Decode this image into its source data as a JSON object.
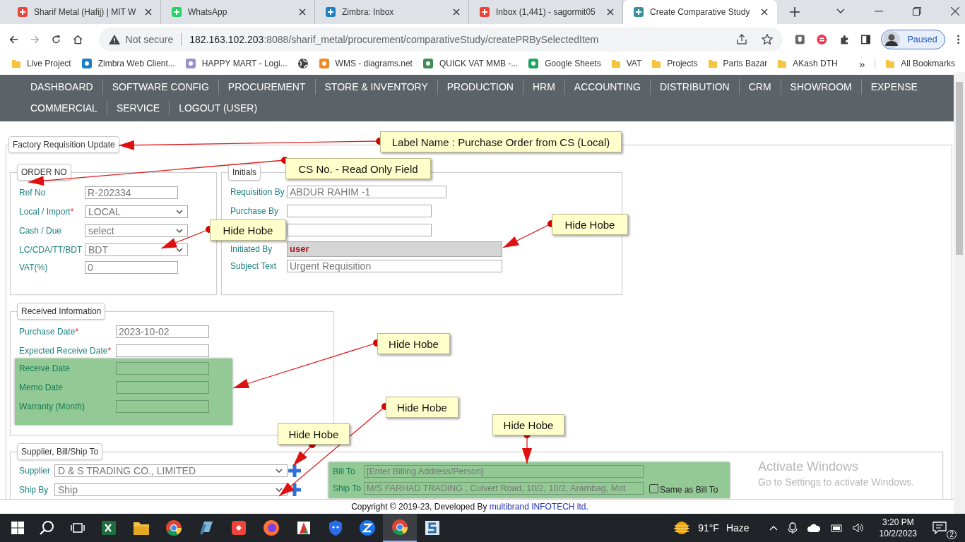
{
  "browser": {
    "tabs": [
      {
        "title": "Sharif Metal (Hafij) | MIT W",
        "selected": false
      },
      {
        "title": "WhatsApp",
        "selected": false
      },
      {
        "title": "Zimbra: Inbox",
        "selected": false
      },
      {
        "title": "Inbox (1,441) - sagormit05",
        "selected": false
      },
      {
        "title": "Create Comparative Study",
        "selected": true
      }
    ],
    "security": "Not secure",
    "url_host": "182.163.102.203",
    "url_path": ":8088/sharif_metal/procurement/comparativeStudy/createPRBySelectedItem",
    "profile_status": "Paused",
    "bookmarks": [
      {
        "label": "Live Project",
        "kind": "folder"
      },
      {
        "label": "Zimbra Web Client...",
        "kind": "site"
      },
      {
        "label": "HAPPY MART - Logi...",
        "kind": "site"
      },
      {
        "kind": "icon"
      },
      {
        "label": "WMS - diagrams.net",
        "kind": "site"
      },
      {
        "label": "QUICK VAT MMB -...",
        "kind": "site"
      },
      {
        "label": "Google Sheets",
        "kind": "site"
      },
      {
        "label": "VAT",
        "kind": "folder"
      },
      {
        "label": "Projects",
        "kind": "folder"
      },
      {
        "label": "Parts Bazar",
        "kind": "folder"
      },
      {
        "label": "AKash DTH",
        "kind": "folder"
      }
    ],
    "bookmarks_more": "»",
    "all_bookmarks": "All Bookmarks"
  },
  "nav_menu": {
    "rows": [
      {
        "items": [
          "DASHBOARD",
          "SOFTWARE CONFIG",
          "PROCUREMENT",
          "STORE & INVENTORY",
          "PRODUCTION",
          "HRM",
          "ACCOUNTING",
          "DISTRIBUTION",
          "CRM",
          "SHOWROOM",
          "EXPENSE"
        ]
      },
      {
        "items": [
          "COMMERCIAL",
          "SERVICE",
          "LOGOUT (USER)"
        ]
      }
    ]
  },
  "form": {
    "title": "Factory Requisition Update",
    "order": {
      "title": "ORDER NO",
      "fields": [
        {
          "label": "Ref No",
          "kind": "text",
          "value": "R-202334"
        },
        {
          "label": "Local / Import",
          "required_mark": "*",
          "kind": "select",
          "value": "LOCAL"
        },
        {
          "label": "Cash / Due",
          "kind": "select",
          "value": "select"
        },
        {
          "label": "LC/CDA/TT/BDT",
          "kind": "select",
          "value": "BDT"
        },
        {
          "label": "VAT(%)",
          "kind": "text",
          "value": "0"
        }
      ]
    },
    "initials": {
      "title": "Initials",
      "fields": [
        {
          "label": "Requisition By",
          "kind": "text",
          "value": "ABDUR RAHIM -1"
        },
        {
          "label": "Purchase By",
          "kind": "text"
        },
        {
          "kind": "text"
        },
        {
          "label": "Initiated By",
          "kind": "text",
          "value": "user",
          "readonly": true
        },
        {
          "label": "Subject Text",
          "kind": "text",
          "value": "Urgent Requisition"
        }
      ]
    },
    "received": {
      "title": "Received Information",
      "fields": [
        {
          "label": "Purchase Date",
          "required_mark": "*",
          "kind": "text",
          "value": "2023-10-02",
          "highlighted": false
        },
        {
          "label": "Expected Receive Date",
          "required_mark": "*",
          "kind": "text",
          "highlighted": false
        },
        {
          "label": "Receive Date",
          "kind": "text",
          "highlighted": true
        },
        {
          "label": "Memo Date",
          "kind": "text",
          "highlighted": true
        },
        {
          "label": "Warranty (Month)",
          "kind": "text",
          "highlighted": true
        }
      ]
    },
    "supplier": {
      "title": "Supplier, Bill/Ship To",
      "fields": [
        {
          "label": "Supplier",
          "kind": "select",
          "value": "D & S TRADING CO., LIMITED"
        },
        {
          "label": "Ship By",
          "kind": "select",
          "value": "Ship"
        }
      ],
      "bill_ship": {
        "highlighted": true,
        "bill_label": "Bill To",
        "bill_placeholder": "[Enter Billing Address/Person]",
        "ship_label": "Ship To",
        "ship_value": "M/S FARHAD TRADING , Culvert Road, 10/2, 10/2, Arambag, Mot",
        "same_label": "Same as Bill To",
        "same_checked": false
      }
    }
  },
  "annotations": [
    {
      "text": "Label Name : Purchase Order from CS (Local)"
    },
    {
      "text": "CS No. - Read Only Field"
    },
    {
      "text": "Hide Hobe"
    },
    {
      "text": "Hide Hobe"
    },
    {
      "text": "Hide Hobe"
    },
    {
      "text": "Hide Hobe"
    },
    {
      "text": "Hide Hobe"
    },
    {
      "text": "Hide Hobe"
    }
  ],
  "footer": {
    "text": "Copyright © 2019-23, Developed By",
    "link": "multibrand INFOTECH ltd."
  },
  "activation": {
    "title": "Activate Windows",
    "subtitle": "Go to Settings to activate Windows."
  },
  "taskbar": {
    "temperature": "91°F",
    "weather": "Haze",
    "time": "3:20 PM",
    "date": "10/2/2023",
    "notifications": "2"
  }
}
